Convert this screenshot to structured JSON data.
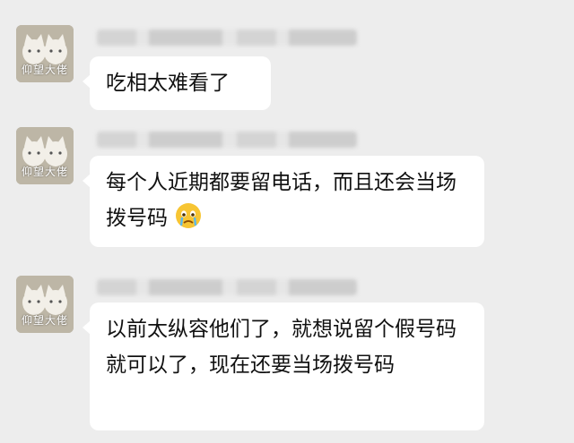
{
  "messages": [
    {
      "avatar_caption": "仰望大佬",
      "sender_name": "██████ ████████ ██████",
      "text": "吃相太难看了"
    },
    {
      "avatar_caption": "仰望大佬",
      "sender_name": "██████ ████████ ██████",
      "text": "每个人近期都要留电话，而且还会当场拨号码",
      "emoji": "crying-face-icon"
    },
    {
      "avatar_caption": "仰望大佬",
      "sender_name": "██████ ████████ ██████",
      "text": "以前太纵容他们了，就想说留个假号码就可以了，现在还要当场拨号码"
    }
  ],
  "colors": {
    "background": "#ededed",
    "bubble": "#ffffff",
    "text": "#111111"
  }
}
